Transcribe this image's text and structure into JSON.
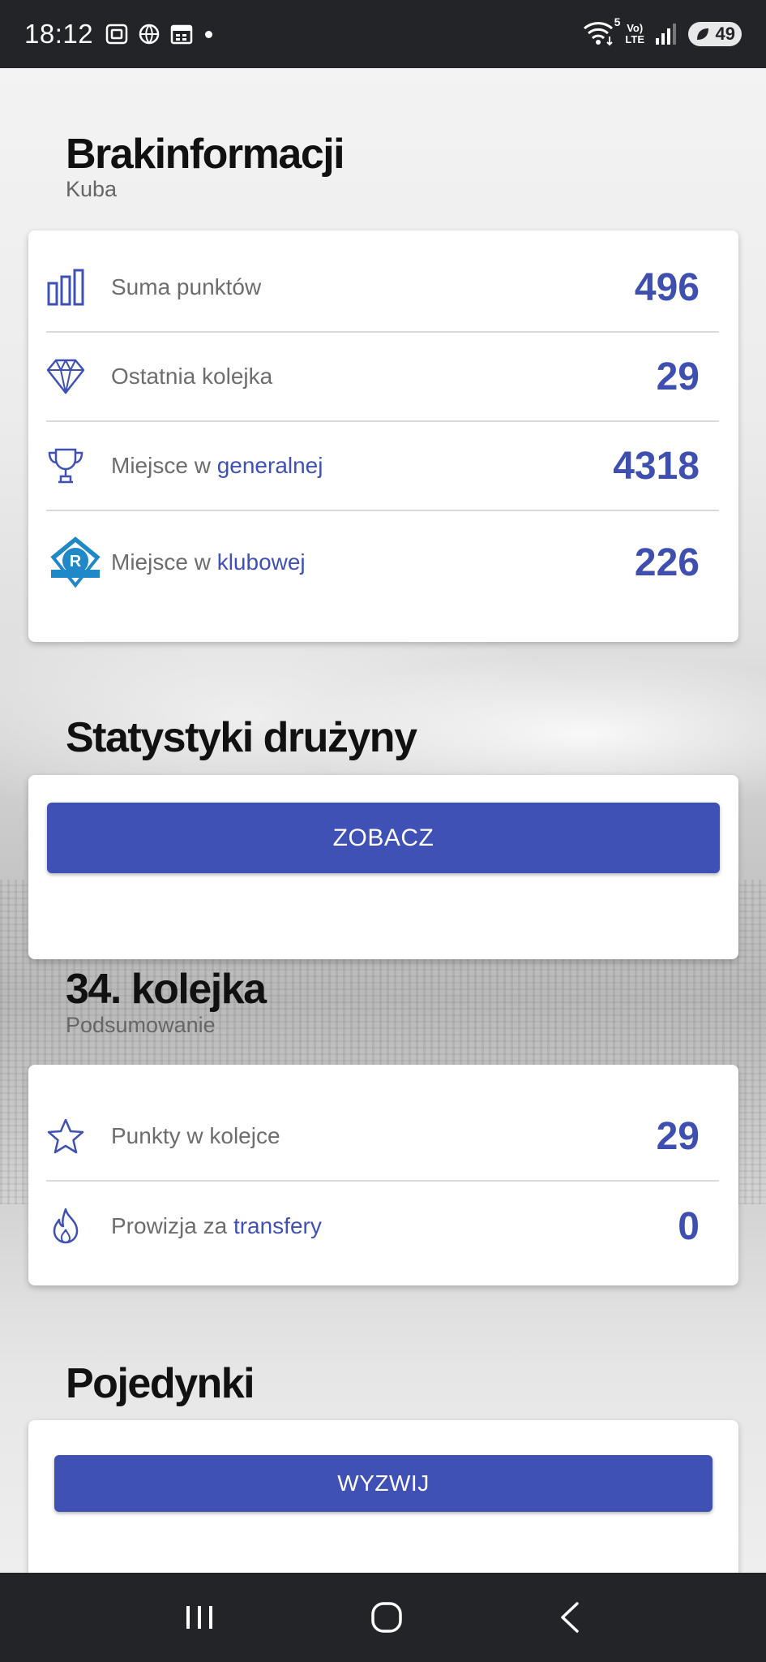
{
  "status_bar": {
    "time": "18:12",
    "network_lte": "Vo)\nLTE",
    "wifi_badge": "5",
    "battery": "49"
  },
  "summary": {
    "title": "Brakinformacji",
    "subtitle": "Kuba",
    "rows": [
      {
        "icon": "bar-chart-icon",
        "label": "Suma punktów",
        "label_highlight": "",
        "value": "496"
      },
      {
        "icon": "diamond-icon",
        "label": "Ostatnia kolejka",
        "label_highlight": "",
        "value": "29"
      },
      {
        "icon": "trophy-icon",
        "label": "Miejsce w ",
        "label_highlight": "generalnej",
        "value": "4318"
      },
      {
        "icon": "club-crest-icon",
        "label": "Miejsce w ",
        "label_highlight": "klubowej",
        "value": "226"
      }
    ]
  },
  "team_stats": {
    "title": "Statystyki drużyny",
    "button_label": "ZOBACZ"
  },
  "round": {
    "title": "34. kolejka",
    "subtitle": "Podsumowanie",
    "rows": [
      {
        "icon": "star-icon",
        "label": "Punkty w kolejce",
        "label_highlight": "",
        "value": "29"
      },
      {
        "icon": "flame-icon",
        "label": "Prowizja za ",
        "label_highlight": "transfery",
        "value": "0"
      }
    ]
  },
  "duels": {
    "title": "Pojedynki",
    "button_label": "WYZWIJ"
  },
  "colors": {
    "accent": "#3f51b5",
    "value_text": "#3f4fb0",
    "system_bar": "#232428"
  }
}
